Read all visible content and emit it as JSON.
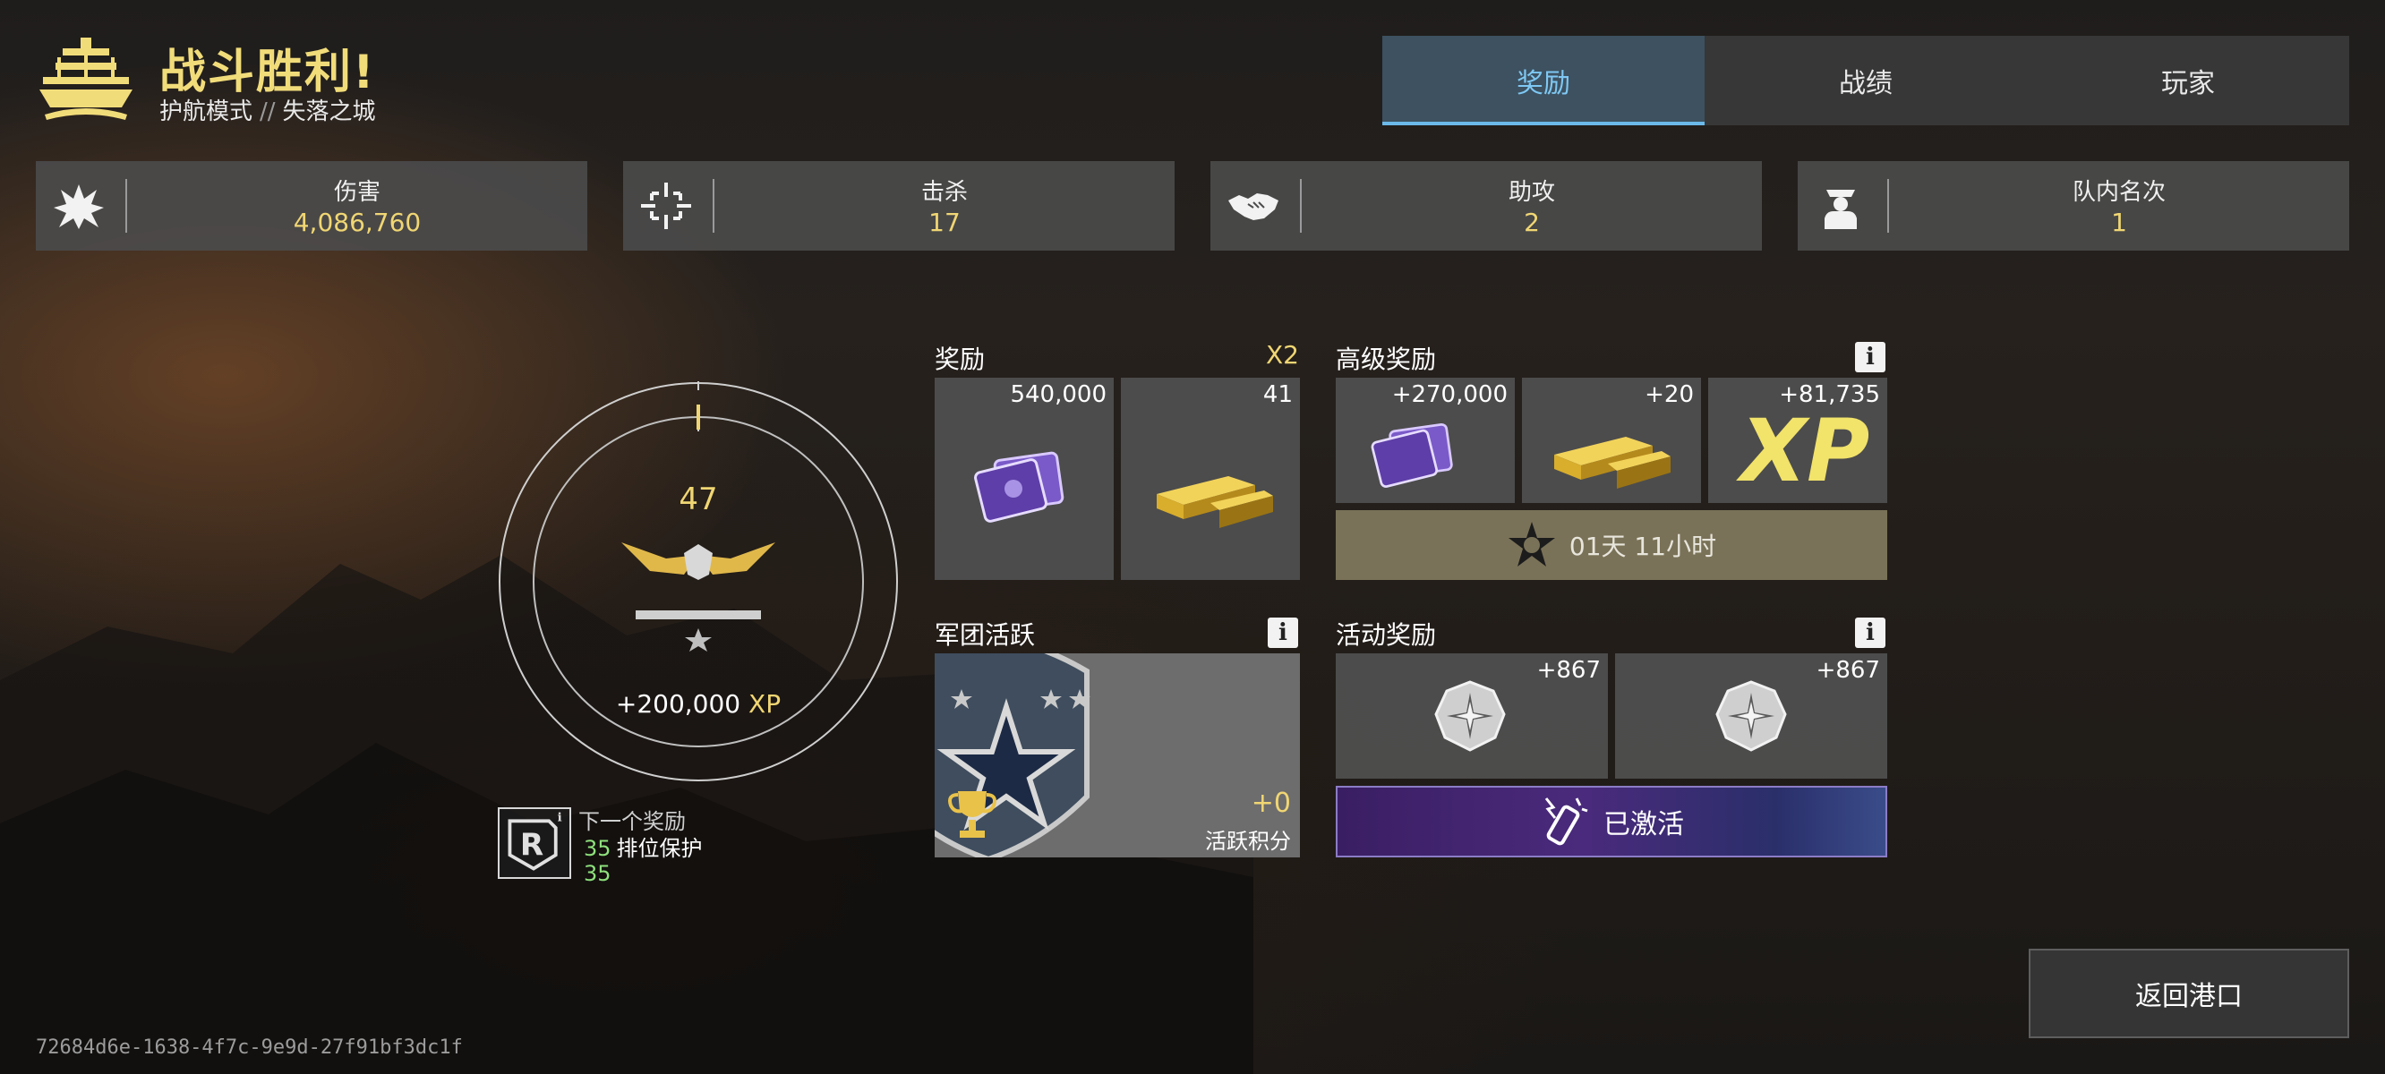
{
  "header": {
    "title": "战斗胜利!",
    "mode": "护航模式",
    "separator": "//",
    "map": "失落之城"
  },
  "tabs": [
    {
      "label": "奖励",
      "active": true
    },
    {
      "label": "战绩",
      "active": false
    },
    {
      "label": "玩家",
      "active": false
    }
  ],
  "stats": [
    {
      "label": "伤害",
      "value": "4,086,760",
      "icon": "explosion-icon"
    },
    {
      "label": "击杀",
      "value": "17",
      "icon": "crosshair-icon"
    },
    {
      "label": "助攻",
      "value": "2",
      "icon": "handshake-icon"
    },
    {
      "label": "队内名次",
      "value": "1",
      "icon": "captain-icon"
    }
  ],
  "rank": {
    "level": "47",
    "progress": 0.01,
    "xp_amount": "+200,000",
    "xp_unit": "XP",
    "next_reward_label": "下一个奖励",
    "next_reward_value": "35",
    "next_reward_name": "排位保护",
    "next_reward_count": "35"
  },
  "rewards": {
    "title": "奖励",
    "multiplier": "X2",
    "items": [
      {
        "amount": "540,000",
        "icon": "credits-icon"
      },
      {
        "amount": "41",
        "icon": "gold-bars-icon"
      }
    ]
  },
  "premium_rewards": {
    "title": "高级奖励",
    "items": [
      {
        "amount": "+270,000",
        "icon": "credits-icon"
      },
      {
        "amount": "+20",
        "icon": "gold-bars-icon"
      },
      {
        "amount": "+81,735",
        "icon": "xp-icon",
        "xp_text": "XP"
      }
    ],
    "timer": "01天 11小时"
  },
  "legion": {
    "title": "军团活跃",
    "points": "+0",
    "points_label": "活跃积分"
  },
  "event_rewards": {
    "title": "活动奖励",
    "items": [
      {
        "amount": "+867",
        "icon": "compass-badge-icon"
      },
      {
        "amount": "+867",
        "icon": "compass-badge-icon"
      }
    ],
    "activated_label": "已激活"
  },
  "return_button": "返回港口",
  "session_id": "72684d6e-1638-4f7c-9e9d-27f91bf3dc1f",
  "colors": {
    "accent_gold": "#f0d673",
    "tab_active": "#7ec8f3",
    "green": "#8ee07c",
    "premium_bar": "#7a7258"
  }
}
